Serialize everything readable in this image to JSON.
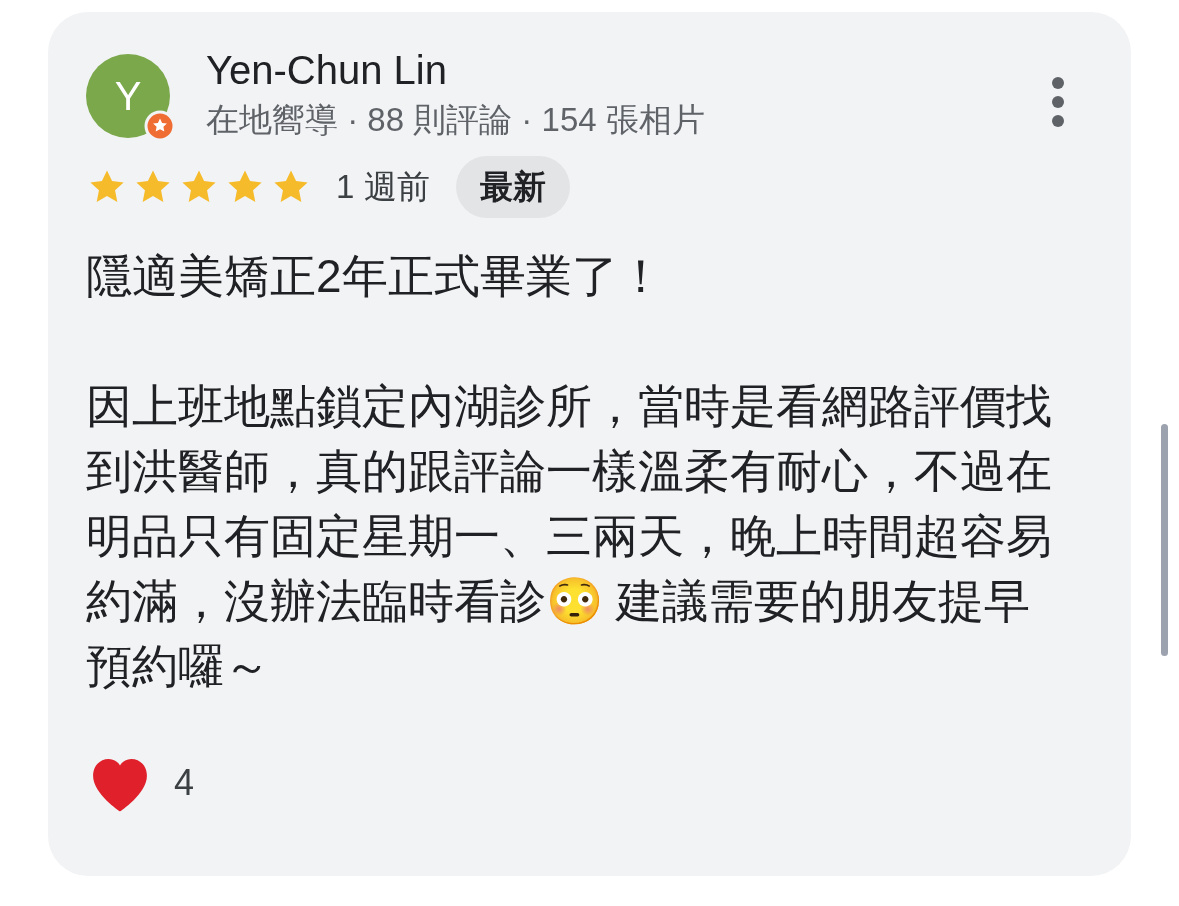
{
  "review": {
    "author": {
      "initial": "Y",
      "name": "Yen-Chun Lin",
      "meta": "在地嚮導 · 88 則評論 · 154 張相片"
    },
    "stars": 5,
    "time": "1 週前",
    "badge": "最新",
    "paragraphs": [
      "隱適美矯正2年正式畢業了！",
      "因上班地點鎖定內湖診所，當時是看網路評價找到洪醫師，真的跟評論一樣溫柔有耐心，不過在明品只有固定星期一、三兩天，晚上時間超容易約滿，沒辦法臨時看診😳 建議需要的朋友提早預約囉～"
    ],
    "likes": "4"
  }
}
